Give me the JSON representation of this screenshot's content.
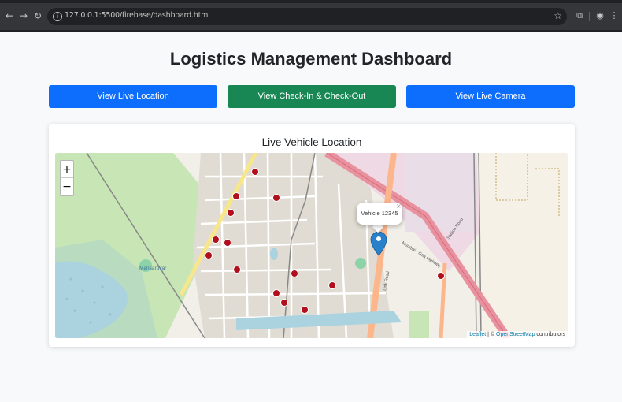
{
  "browser": {
    "url": "127.0.0.1:5500/firebase/dashboard.html",
    "icons": {
      "back": "arrow-left-icon",
      "forward": "arrow-right-icon",
      "reload": "reload-icon",
      "site_info": "info-icon",
      "bookmark": "star-icon",
      "extensions": "puzzle-icon",
      "profile": "profile-icon",
      "menu": "kebab-menu-icon"
    }
  },
  "page": {
    "title": "Logistics Management Dashboard"
  },
  "buttons": {
    "live_location": "View Live Location",
    "checkin_checkout": "View Check-In & Check-Out",
    "live_camera": "View Live Camera"
  },
  "card": {
    "title": "Live Vehicle Location"
  },
  "map": {
    "zoom_in": "+",
    "zoom_out": "−",
    "popup_text": "Vehicle 12345",
    "popup_close": "×",
    "labels": {
      "place": "Mansarovar",
      "road_1": "Mumbai - Goa Highway",
      "road_2": "Station Road",
      "road_3": "Link Road"
    },
    "attribution": {
      "leaflet": "Leaflet",
      "separator": " | © ",
      "osm": "OpenStreetMap",
      "suffix": " contributors"
    }
  },
  "colors": {
    "primary": "#0d6efd",
    "success": "#198754",
    "marker": "#2a81cb"
  }
}
